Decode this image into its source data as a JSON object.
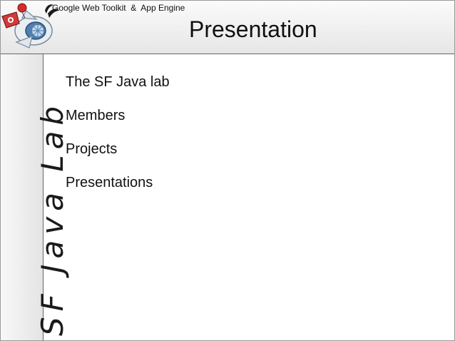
{
  "header": {
    "subtitle": "Google Web Toolkit  &  App Engine",
    "title": "Presentation"
  },
  "sidebar": {
    "label": "SF Java Lab"
  },
  "content": {
    "items": [
      {
        "label": "The SF Java lab"
      },
      {
        "label": "Members"
      },
      {
        "label": "Projects"
      },
      {
        "label": "Presentations"
      }
    ]
  },
  "colors": {
    "header_bg": "#e8e8e8",
    "border": "#666666",
    "text": "#111111"
  }
}
